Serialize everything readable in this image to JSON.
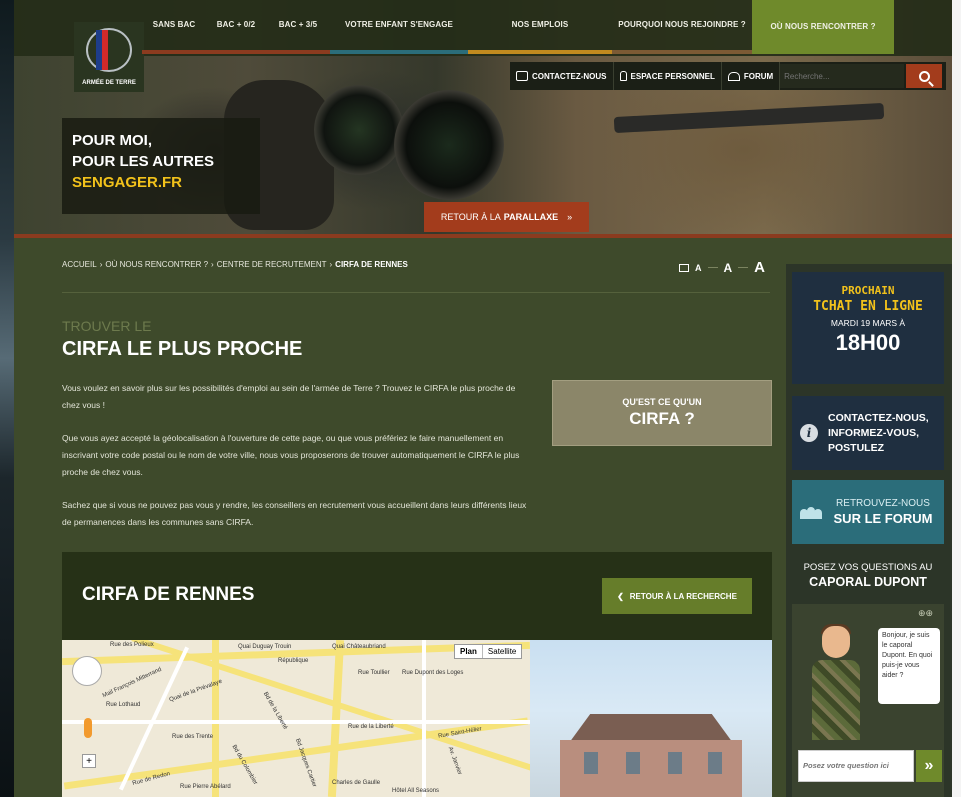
{
  "nav": {
    "items": [
      {
        "label": "SANS BAC"
      },
      {
        "label": "BAC + 0/2"
      },
      {
        "label": "BAC + 3/5"
      },
      {
        "label": "VOTRE ENFANT S'ENGAGE"
      },
      {
        "label": "NOS EMPLOIS"
      },
      {
        "label": "POURQUOI NOUS REJOINDRE ?"
      },
      {
        "label": "OÙ NOUS RENCONTRER ?"
      }
    ],
    "line_colors": [
      "#8b3b1f",
      "#8b3b1f",
      "#8b3b1f",
      "#2b6d7a",
      "#c18a1f",
      "#7c5a34",
      "#6f8a2b"
    ]
  },
  "logo": {
    "text": "ARMÉE DE TERRE"
  },
  "utility": {
    "contact_label": "CONTACTEZ-NOUS",
    "espace_label": "ESPACE PERSONNEL",
    "forum_label": "FORUM",
    "search_placeholder": "Recherche..."
  },
  "hero": {
    "line1": "POUR MOI,",
    "line2": "POUR LES AUTRES",
    "line3": "SENGAGER.FR",
    "parallax_prefix": "RETOUR À LA",
    "parallax_bold": "PARALLAXE",
    "parallax_icon": "double-chevron-down-icon"
  },
  "breadcrumb": {
    "items": [
      "ACCUEIL",
      "OÙ NOUS RENCONTRER ?",
      "CENTRE DE RECRUTEMENT"
    ],
    "current": "CIRFA DE RENNES",
    "sep": "›"
  },
  "font_size": {
    "small": "A",
    "medium": "A",
    "large": "A"
  },
  "main": {
    "kicker": "TROUVER LE",
    "title": "CIRFA LE PLUS PROCHE",
    "p1": "Vous voulez en savoir plus sur les possibilités d'emploi au sein de l'armée de Terre ? Trouvez le CIRFA le plus proche de chez vous !",
    "p2": "Que vous ayez accepté la géolocalisation à l'ouverture de cette page, ou que vous préfériez le faire manuellement en inscrivant votre code postal ou le nom de votre ville, nous vous proposerons de trouver automatiquement le CIRFA le plus proche de chez vous.",
    "p3": "Sachez que si vous ne pouvez pas vous y rendre, les conseillers en recrutement vous accueillent dans leurs différents lieux de permanences dans les communes sans CIRFA.",
    "cirfa_q1": "QU'EST CE QU'UN",
    "cirfa_q2": "CIRFA ?",
    "rennes_title": "CIRFA DE RENNES",
    "back_label": "RETOUR À LA RECHERCHE"
  },
  "map": {
    "plan": "Plan",
    "satellite": "Satellite",
    "labels": [
      "Rue des Polieux",
      "Quai Duguay Trouin",
      "Quai Châteaubriand",
      "République",
      "Mail François Mitterrand",
      "Rue Lothaud",
      "Quai de la Prévalaye",
      "Rue Toullier",
      "Rue Dupont des Loges",
      "Bd de la Liberté",
      "Rue des Trente",
      "Rue de la Liberté",
      "Rue Saint-Hélier",
      "Bd du Colombier",
      "Rue de Redon",
      "Charles de Gaulle",
      "Hôtel All Seasons",
      "Av. Janvier",
      "Bd Jacques Cartier",
      "Rue Pierre Abélard"
    ]
  },
  "sidebar": {
    "tchat_1": "PROCHAIN",
    "tchat_2": "TCHAT EN LIGNE",
    "tchat_date": "MARDI 19 MARS À",
    "tchat_time": "18H00",
    "contact_1": "CONTACTEZ-NOUS,",
    "contact_2": "INFORMEZ-VOUS,",
    "contact_3": "POSTULEZ",
    "forum_1": "RETROUVEZ-NOUS",
    "forum_2": "SUR LE FORUM",
    "caporal_1": "POSEZ VOS QUESTIONS AU",
    "caporal_2": "CAPORAL DUPONT",
    "bubble": "Bonjour, je suis le caporal Dupont. En quoi puis-je vous aider ?",
    "question_placeholder": "Posez votre question ici",
    "send": "»"
  }
}
